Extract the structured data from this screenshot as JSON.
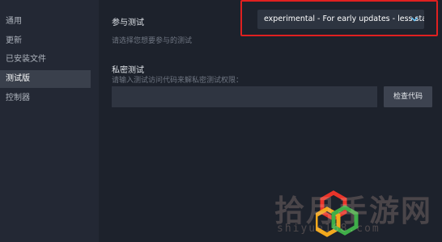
{
  "sidebar": {
    "items": [
      {
        "label": "通用",
        "active": false
      },
      {
        "label": "更新",
        "active": false
      },
      {
        "label": "已安装文件",
        "active": false
      },
      {
        "label": "测试版",
        "active": true
      },
      {
        "label": "控制器",
        "active": false
      }
    ]
  },
  "beta": {
    "title": "参与测试",
    "description": "请选择您想要参与的测试",
    "selected": "experimental - For early updates - less stable"
  },
  "private_beta": {
    "title": "私密测试",
    "description": "请输入测试访问代码来解私密测试权限：",
    "input_value": "",
    "check_button": "检查代码"
  },
  "watermark": {
    "text": "拾月手游网",
    "url": "shiyue168.com"
  },
  "colors": {
    "highlight": "#e02020",
    "sidebar_active": "#3a404c",
    "accent_chevron": "#66c0f4"
  }
}
